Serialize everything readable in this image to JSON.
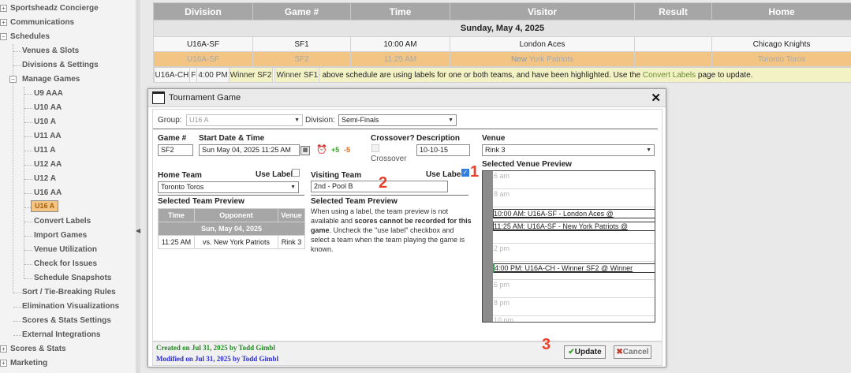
{
  "sidebar": {
    "items": [
      {
        "label": "Sportsheadz Concierge"
      },
      {
        "label": "Communications"
      },
      {
        "label": "Schedules"
      },
      {
        "label": "Venues & Slots"
      },
      {
        "label": "Divisions & Settings"
      },
      {
        "label": "Manage Games"
      },
      {
        "label": "U9 AAA"
      },
      {
        "label": "U10 AA"
      },
      {
        "label": "U10 A"
      },
      {
        "label": "U11 AA"
      },
      {
        "label": "U11 A"
      },
      {
        "label": "U12 AA"
      },
      {
        "label": "U12 A"
      },
      {
        "label": "U16 AA"
      },
      {
        "label": "U16 A"
      },
      {
        "label": "Convert Labels"
      },
      {
        "label": "Import Games"
      },
      {
        "label": "Venue Utilization"
      },
      {
        "label": "Check for Issues"
      },
      {
        "label": "Schedule Snapshots"
      },
      {
        "label": "Sort / Tie-Breaking Rules"
      },
      {
        "label": "Elimination Visualizations"
      },
      {
        "label": "Scores & Stats Settings"
      },
      {
        "label": "External Integrations"
      },
      {
        "label": "Scores & Stats"
      },
      {
        "label": "Marketing"
      }
    ],
    "expander_plus": "+",
    "expander_minus": "−",
    "collapse_arrow": "◀"
  },
  "schedule": {
    "headers": [
      "Division",
      "Game #",
      "Time",
      "Visitor",
      "Result",
      "Home"
    ],
    "date": "Sunday, May 4, 2025",
    "rows": [
      {
        "division": "U16A-SF",
        "game": "SF1",
        "time": "10:00 AM",
        "visitor": "London Aces",
        "result": "",
        "home": "Chicago Knights"
      },
      {
        "division": "U16A-SF",
        "game": "SF2",
        "time": "11:25 AM",
        "visitor_new": "New",
        "visitor_rest": " York Patriots",
        "result": "",
        "home": "Toronto Toros"
      },
      {
        "division": "U16A-CH",
        "game": "F",
        "time": "4:00 PM",
        "visitor": "Winner SF2",
        "result": "",
        "home": "Winner SF1"
      }
    ],
    "note_pre": "Some games in the above schedule are using labels for one or both teams, and have been highlighted. Use the ",
    "note_link": "Convert Labels",
    "note_post": " page to update."
  },
  "dialog": {
    "title": "Tournament Game",
    "close": "✕",
    "group_label": "Group:",
    "group_value": "U16 A",
    "division_label": "Division:",
    "division_value": "Semi-Finals",
    "game_label": "Game #",
    "game_value": "SF2",
    "start_label": "Start Date & Time",
    "start_value": "Sun May 04, 2025  11:25 AM",
    "crossover_label": "Crossover?",
    "crossover_sub": "Crossover",
    "description_label": "Description",
    "description_value": "10-10-15",
    "venue_label": "Venue",
    "venue_value": "Rink 3",
    "home_label": "Home Team",
    "home_use_label": "Use Label",
    "home_value": "Toronto Toros",
    "visiting_label": "Visiting Team",
    "visiting_use_label": "Use Label",
    "visiting_value": "2nd - Pool B",
    "team_preview_title": "Selected Team Preview",
    "team_preview": {
      "headers": [
        "Time",
        "Opponent",
        "Venue"
      ],
      "date": "Sun, May 04, 2025",
      "rows": [
        {
          "time": "11:25 AM",
          "opponent": "vs. New York Patriots",
          "venue": "Rink 3"
        }
      ]
    },
    "visiting_preview_title": "Selected Team Preview",
    "visiting_preview_p1": "When using a label, the team preview is not available and ",
    "visiting_preview_bold": "scores cannot be recorded for this game",
    "visiting_preview_p2": ". Uncheck the \"use label\" checkbox and select a team when the team playing the game is known.",
    "venue_preview_title": "Selected Venue Preview",
    "venue_preview": {
      "times": [
        "6 am",
        "8 am",
        "2 pm",
        "6 pm",
        "8 pm",
        "10 pm"
      ],
      "slots": [
        "10:00 AM: U16A-SF - London Aces @",
        "11:25 AM: U16A-SF - New York Patriots @",
        "4:00 PM: U16A-CH - Winner SF2 @ Winner"
      ]
    },
    "created": "Created on Jul 31, 2025 by Todd Gimbl",
    "modified": "Modified on Jul 31, 2025 by Todd Gimbl",
    "update_label": "Update",
    "cancel_label": "Cancel",
    "icons": {
      "calendar": "calendar-icon",
      "clock": "alarm-clock-icon",
      "plus5": "+5",
      "minus5": "-5"
    },
    "markers": [
      "1",
      "2",
      "3"
    ]
  },
  "colors": {
    "highlight": "#f3c585",
    "label_yellow": "#f2f2c5",
    "header_gray": "#a6a6a6",
    "marker_red": "#e8412c"
  }
}
